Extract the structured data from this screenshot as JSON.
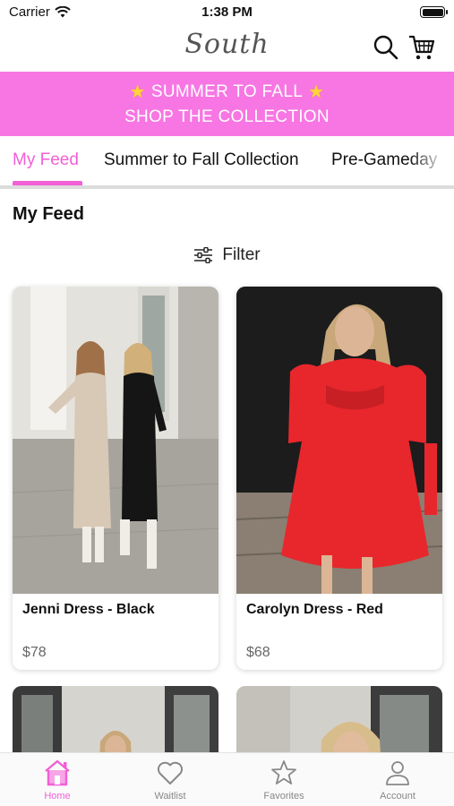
{
  "status_bar": {
    "carrier": "Carrier",
    "time": "1:38 PM"
  },
  "header": {
    "logo_text": "South",
    "icons": [
      "search-icon",
      "cart-icon"
    ]
  },
  "promo": {
    "line1": "SUMMER TO FALL",
    "line2": "SHOP THE COLLECTION",
    "background": "#f776e3",
    "star_icon": "star-emoji"
  },
  "tabs": [
    {
      "label": "My Feed",
      "active": true
    },
    {
      "label": "Summer to Fall Collection",
      "active": false
    },
    {
      "label": "Pre-Gameday",
      "active": false
    }
  ],
  "section": {
    "title": "My Feed",
    "filter_label": "Filter"
  },
  "products": [
    {
      "name": "Jenni Dress - Black",
      "price": "$78"
    },
    {
      "name": "Carolyn Dress - Red",
      "price": "$68"
    }
  ],
  "bottom_nav": [
    {
      "label": "Home",
      "icon": "home-icon",
      "active": true
    },
    {
      "label": "Waitlist",
      "icon": "heart-icon",
      "active": false
    },
    {
      "label": "Favorites",
      "icon": "star-icon",
      "active": false
    },
    {
      "label": "Account",
      "icon": "user-icon",
      "active": false
    }
  ],
  "colors": {
    "accent": "#f25fd6",
    "promo": "#f776e3",
    "inactive": "#888888"
  }
}
